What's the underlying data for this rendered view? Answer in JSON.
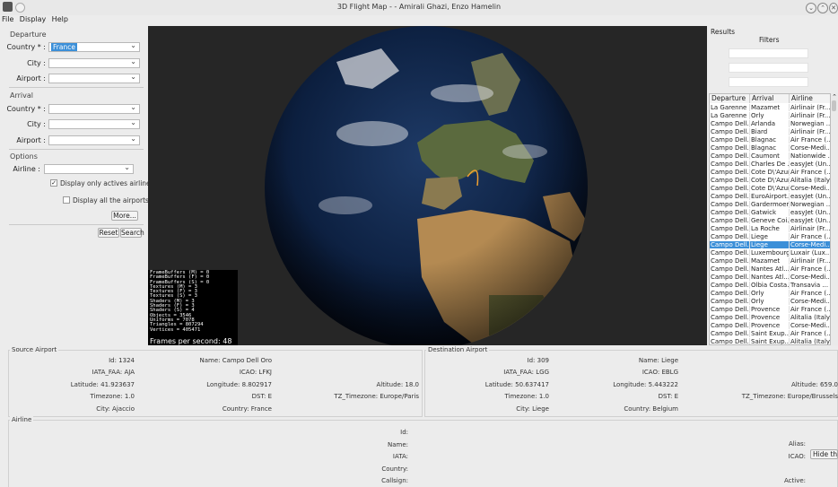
{
  "window": {
    "title": "3D Flight Map - - Amirali Ghazi, Enzo Hamelin"
  },
  "menu": {
    "file": "File",
    "display": "Display",
    "help": "Help"
  },
  "departure": {
    "section": "Departure",
    "country_label": "Country * :",
    "country_value": "France",
    "city_label": "City :",
    "city_value": "",
    "airport_label": "Airport :",
    "airport_value": ""
  },
  "arrival": {
    "section": "Arrival",
    "country_label": "Country * :",
    "country_value": "",
    "city_label": "City :",
    "city_value": "",
    "airport_label": "Airport :",
    "airport_value": ""
  },
  "options": {
    "section": "Options",
    "airline_label": "Airline :",
    "airline_value": "",
    "only_active": "Display only actives airlines",
    "only_active_checked": true,
    "all_airports": "Display all the airports",
    "all_airports_checked": false,
    "more": "More...",
    "reset": "Reset",
    "search": "Search"
  },
  "stats": {
    "lines": [
      "FrameBuffers (M) = 0",
      "FrameBuffers (F) = 0",
      "FrameBuffers (S) = 0",
      "Textures (M) = 3",
      "Textures (F) = 3",
      "Textures (S) = 3",
      "Shaders (M) = 3",
      "Shaders (F) = 3",
      "Shaders (S) = 4",
      "Objects = 3546",
      "Uniforms = 7078",
      "Triangles = 807294",
      "Vertices = 405471"
    ],
    "fps": "Frames per second: 48"
  },
  "results": {
    "title": "Results",
    "filters": "Filters",
    "columns": [
      "Departure",
      "Arrival",
      "Airline"
    ],
    "rows": [
      [
        "La Garenne",
        "Mazamet",
        "Airlinair (Fr..."
      ],
      [
        "La Garenne",
        "Orly",
        "Airlinair (Fr..."
      ],
      [
        "Campo Dell...",
        "Arlanda",
        "Norwegian ..."
      ],
      [
        "Campo Dell...",
        "Biard",
        "Airlinair (Fr..."
      ],
      [
        "Campo Dell...",
        "Blagnac",
        "Air France (..."
      ],
      [
        "Campo Dell...",
        "Blagnac",
        "Corse-Medi..."
      ],
      [
        "Campo Dell...",
        "Caumont",
        "Nationwide ..."
      ],
      [
        "Campo Dell...",
        "Charles De ...",
        "easyJet (Un..."
      ],
      [
        "Campo Dell...",
        "Cote D\\'Azur",
        "Air France (..."
      ],
      [
        "Campo Dell...",
        "Cote D\\'Azur",
        "Alitalia (Italy)"
      ],
      [
        "Campo Dell...",
        "Cote D\\'Azur",
        "Corse-Medi..."
      ],
      [
        "Campo Dell...",
        "EuroAirport...",
        "easyJet (Un..."
      ],
      [
        "Campo Dell...",
        "Gardermoen",
        "Norwegian ..."
      ],
      [
        "Campo Dell...",
        "Gatwick",
        "easyJet (Un..."
      ],
      [
        "Campo Dell...",
        "Geneve Coi...",
        "easyJet (Un..."
      ],
      [
        "Campo Dell...",
        "La Roche",
        "Airlinair (Fr..."
      ],
      [
        "Campo Dell...",
        "Liege",
        "Air France (..."
      ],
      [
        "Campo Dell...",
        "Liege",
        "Corse-Medi..."
      ],
      [
        "Campo Dell...",
        "Luxembourg",
        "Luxair (Lux..."
      ],
      [
        "Campo Dell...",
        "Mazamet",
        "Airlinair (Fr..."
      ],
      [
        "Campo Dell...",
        "Nantes Atl...",
        "Air France (..."
      ],
      [
        "Campo Dell...",
        "Nantes Atl...",
        "Corse-Medi..."
      ],
      [
        "Campo Dell...",
        "Olbia Costa...",
        "Transavia ..."
      ],
      [
        "Campo Dell...",
        "Orly",
        "Air France (..."
      ],
      [
        "Campo Dell...",
        "Orly",
        "Corse-Medi..."
      ],
      [
        "Campo Dell...",
        "Provence",
        "Air France (..."
      ],
      [
        "Campo Dell...",
        "Provence",
        "Alitalia (Italy)"
      ],
      [
        "Campo Dell...",
        "Provence",
        "Corse-Medi..."
      ],
      [
        "Campo Dell...",
        "Saint Exup...",
        "Air France (..."
      ],
      [
        "Campo Dell...",
        "Saint Exup...",
        "Alitalia (Italy)"
      ]
    ],
    "selected_row": 17
  },
  "source": {
    "title": "Source Airport",
    "id": "Id: 1324",
    "name": "Name: Campo Dell Oro",
    "iata": "IATA_FAA: AJA",
    "icao": "ICAO: LFKJ",
    "lat": "Latitude: 41.923637",
    "lon": "Longitude: 8.802917",
    "alt": "Altitude: 18.0",
    "tz": "Timezone: 1.0",
    "dst": "DST: E",
    "tzname": "TZ_Timezone: Europe/Paris",
    "city": "City: Ajaccio",
    "country": "Country: France"
  },
  "dest": {
    "title": "Destination Airport",
    "id": "Id: 309",
    "name": "Name: Liege",
    "iata": "IATA_FAA: LGG",
    "icao": "ICAO: EBLG",
    "lat": "Latitude: 50.637417",
    "lon": "Longitude: 5.443222",
    "alt": "Altitude: 659.0",
    "tz": "Timezone: 1.0",
    "dst": "DST: E",
    "tzname": "TZ_Timezone: Europe/Brussels",
    "city": "City: Liege",
    "country": "Country: Belgium"
  },
  "airline": {
    "title": "Airline",
    "id": "Id:",
    "name": "Name:",
    "iata": "IATA:",
    "country": "Country:",
    "callsign": "Callsign:",
    "alias": "Alias:",
    "icao": "ICAO:",
    "active": "Active:",
    "hide_button": "Hide this"
  }
}
